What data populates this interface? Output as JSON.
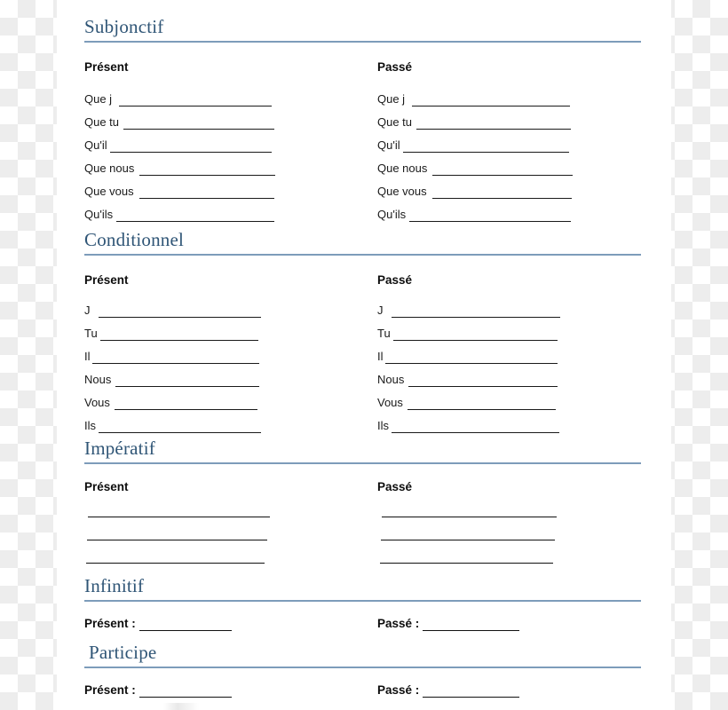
{
  "document": {
    "type": "french-verb-conjugation-worksheet",
    "accent_color": "#2f5576",
    "rule_color": "#7d9cba"
  },
  "sections": [
    {
      "id": "subjonctif",
      "title": "Subjonctif",
      "columns": [
        {
          "id": "present",
          "heading": "Présent",
          "rows": [
            "Que j",
            "Que tu",
            "Qu'il",
            "Que nous",
            "Que vous",
            "Qu'ils"
          ]
        },
        {
          "id": "passe",
          "heading": "Passé",
          "rows": [
            "Que j",
            "Que tu",
            "Qu'il",
            "Que nous",
            "Que vous",
            "Qu'ils"
          ]
        }
      ]
    },
    {
      "id": "conditionnel",
      "title": "Conditionnel",
      "columns": [
        {
          "id": "present",
          "heading": "Présent",
          "rows": [
            "J",
            "Tu",
            "Il",
            "Nous",
            "Vous",
            "Ils"
          ]
        },
        {
          "id": "passe",
          "heading": "Passé",
          "rows": [
            "J",
            "Tu",
            "Il",
            "Nous",
            "Vous",
            "Ils"
          ]
        }
      ]
    },
    {
      "id": "imperatif",
      "title": "Impératif",
      "columns": [
        {
          "id": "present",
          "heading": "Présent",
          "rows": [
            "",
            "",
            ""
          ]
        },
        {
          "id": "passe",
          "heading": "Passé",
          "rows": [
            "",
            "",
            ""
          ]
        }
      ]
    },
    {
      "id": "infinitif",
      "title": "Infinitif",
      "columns": [
        {
          "id": "present",
          "heading": "Présent :",
          "rows": []
        },
        {
          "id": "passe",
          "heading": "Passé :",
          "rows": []
        }
      ]
    },
    {
      "id": "participe",
      "title": "Participe",
      "columns": [
        {
          "id": "present",
          "heading": "Présent :",
          "rows": []
        },
        {
          "id": "passe",
          "heading": "Passé :",
          "rows": []
        }
      ]
    }
  ]
}
